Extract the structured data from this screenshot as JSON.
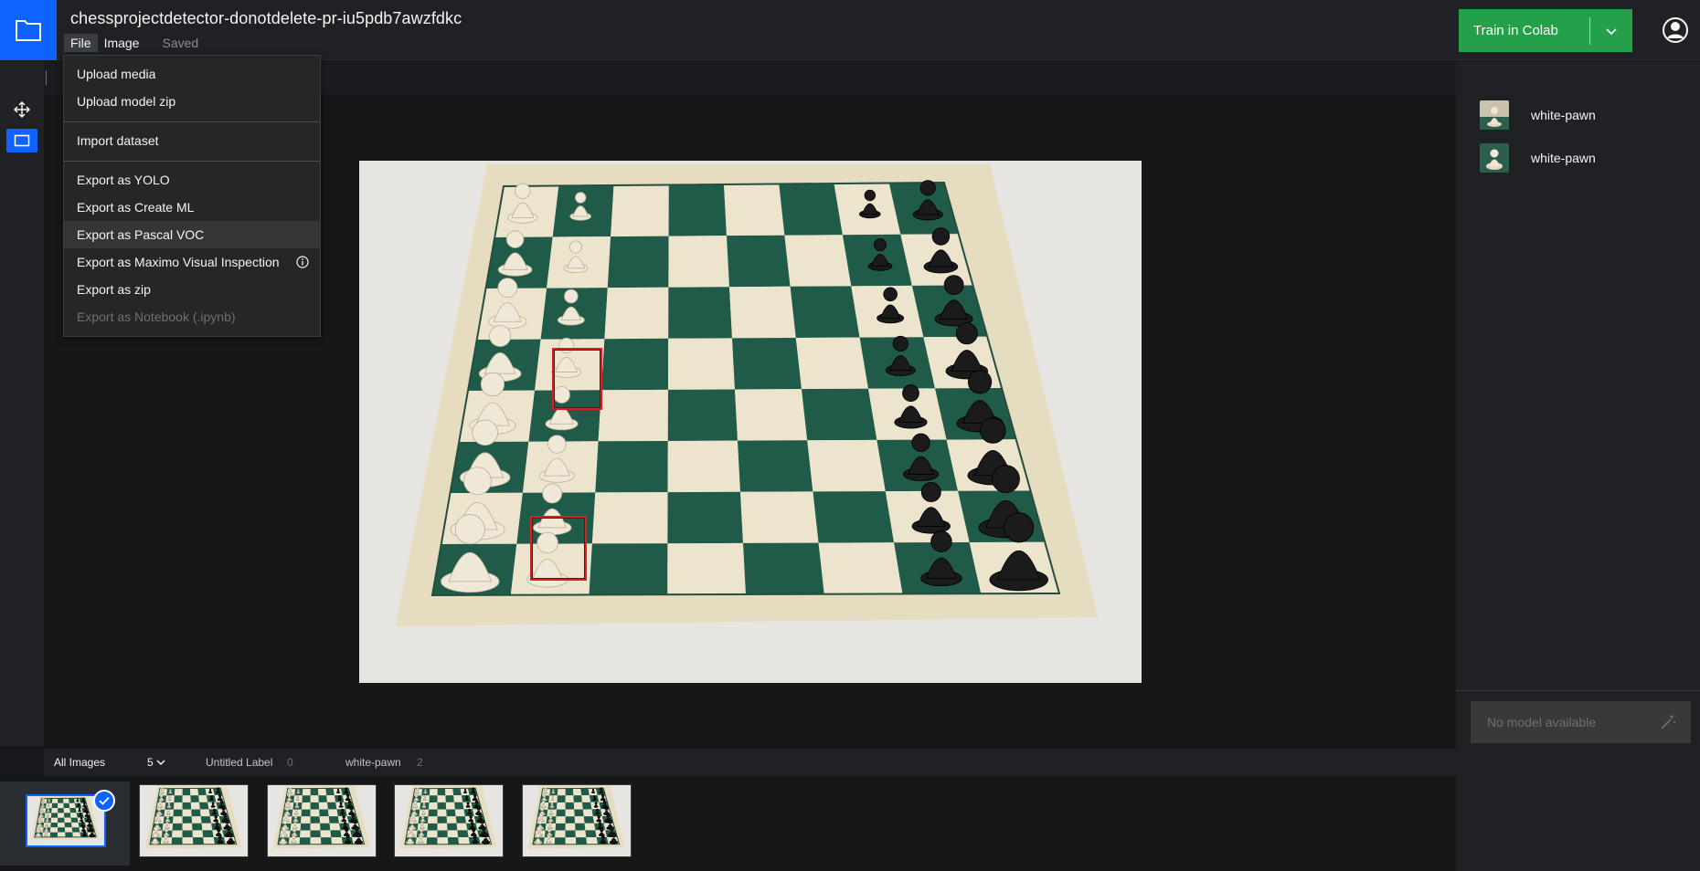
{
  "header": {
    "project_title": "chessprojectdetector-donotdelete-pr-iu5pdb7awzfdkc",
    "menu_file": "File",
    "menu_image": "Image",
    "saved_status": "Saved",
    "train_button": "Train in Colab"
  },
  "file_menu": {
    "upload_media": "Upload media",
    "upload_model_zip": "Upload model zip",
    "import_dataset": "Import dataset",
    "export_yolo": "Export as YOLO",
    "export_create_ml": "Export as Create ML",
    "export_pascal_voc": "Export as Pascal VOC",
    "export_maximo": "Export as Maximo Visual Inspection",
    "export_zip": "Export as zip",
    "export_notebook": "Export as Notebook (.ipynb)"
  },
  "right_panel": {
    "labels": [
      {
        "name": "white-pawn"
      },
      {
        "name": "white-pawn"
      }
    ],
    "model_placeholder": "No model available"
  },
  "filter_bar": {
    "all_images": "All Images",
    "image_count": "5",
    "untitled_label": "Untitled Label",
    "untitled_count": "0",
    "white_pawn_label": "white-pawn",
    "white_pawn_count": "2"
  },
  "colors": {
    "accent_blue": "#0f62fe",
    "train_green": "#24a148",
    "bbox_red": "#da1e28",
    "board_green": "#1f5b48",
    "board_cream": "#ece4cc"
  },
  "icons": [
    "folder-icon",
    "chevron-down-icon",
    "user-avatar-icon",
    "move-icon",
    "bounding-box-icon",
    "info-icon",
    "magic-wand-icon",
    "checkmark-icon"
  ]
}
